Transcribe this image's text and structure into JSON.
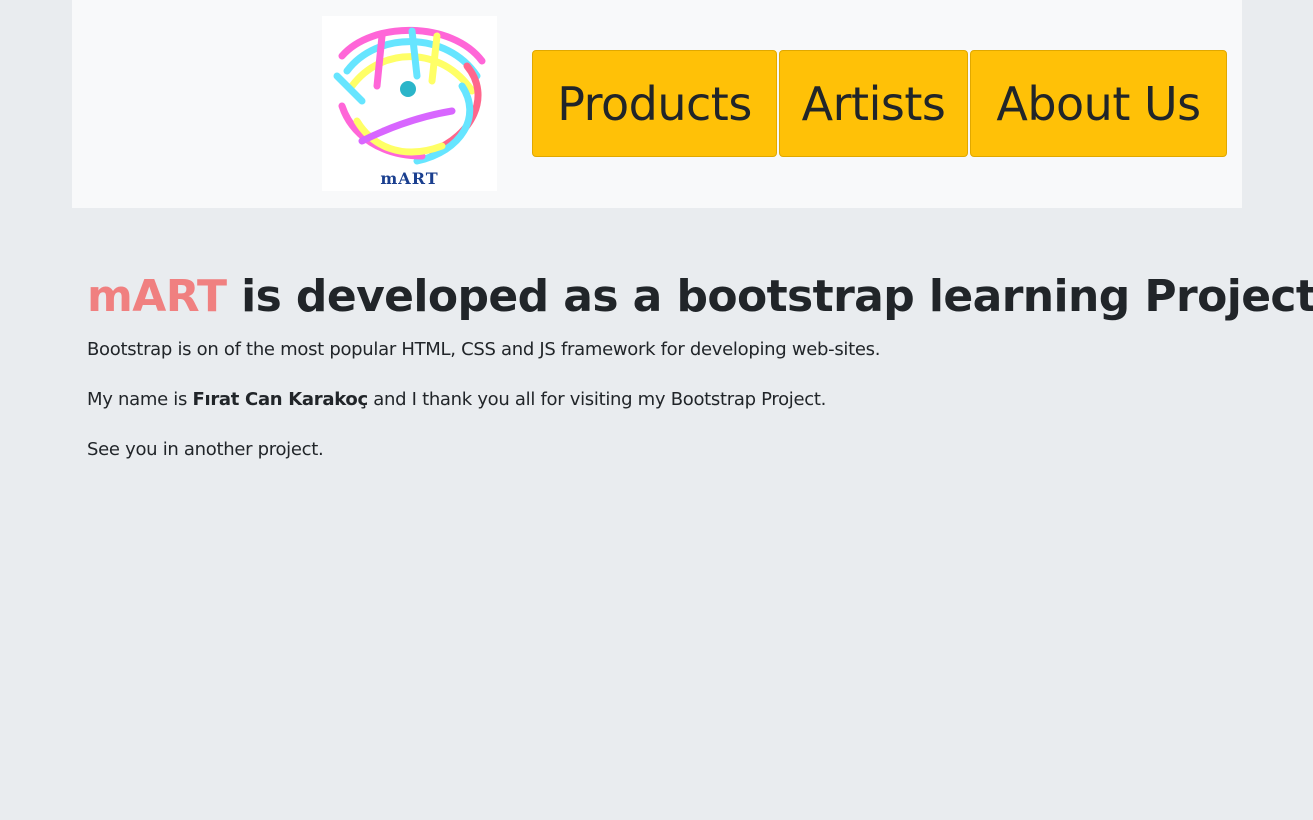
{
  "header": {
    "logo_text": "mART",
    "nav": {
      "products": "Products",
      "artists": "Artists",
      "about": "About Us"
    }
  },
  "content": {
    "headline_brand": "mART",
    "headline_rest": " is developed as a bootstrap learning Project",
    "paragraph1": "Bootstrap is on of the most popular HTML, CSS and JS framework for developing web-sites.",
    "paragraph2_prefix": "My name is ",
    "paragraph2_name": "Fırat Can Karakoç",
    "paragraph2_suffix": " and I thank you all for visiting my Bootstrap Project.",
    "paragraph3": "See you in another project."
  },
  "colors": {
    "page_background": "#e9ecef",
    "header_background": "#f8f9fa",
    "nav_button": "#ffc107",
    "brand_accent": "#f08080",
    "text": "#212529"
  }
}
